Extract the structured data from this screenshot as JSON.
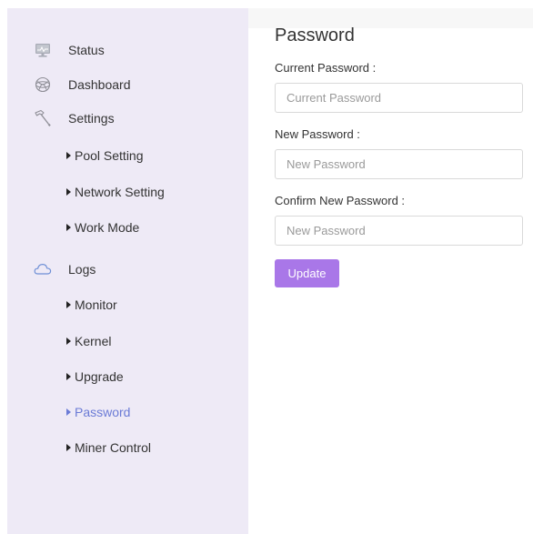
{
  "sidebar": {
    "items": [
      {
        "label": "Status",
        "icon": "monitor-icon"
      },
      {
        "label": "Dashboard",
        "icon": "dashboard-icon"
      },
      {
        "label": "Settings",
        "icon": "hammer-icon"
      },
      {
        "label": "Logs",
        "icon": "cloud-icon"
      }
    ],
    "settings_subitems": [
      {
        "label": "Pool Setting"
      },
      {
        "label": "Network Setting"
      },
      {
        "label": "Work Mode"
      }
    ],
    "logs_subitems": [
      {
        "label": "Monitor"
      },
      {
        "label": "Kernel"
      },
      {
        "label": "Upgrade"
      },
      {
        "label": "Password",
        "active": true
      },
      {
        "label": "Miner Control"
      }
    ]
  },
  "main": {
    "title": "Password",
    "fields": [
      {
        "label": "Current Password :",
        "placeholder": "Current Password",
        "value": ""
      },
      {
        "label": "New Password :",
        "placeholder": "New Password",
        "value": ""
      },
      {
        "label": "Confirm New Password :",
        "placeholder": "New Password",
        "value": ""
      }
    ],
    "update_label": "Update"
  },
  "colors": {
    "sidebar_bg": "#eeeaf6",
    "accent_button": "#a977e8",
    "active_link": "#6b7bd6",
    "input_border": "#d9d9d9"
  }
}
